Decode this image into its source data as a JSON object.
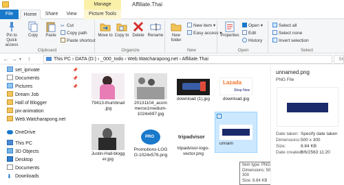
{
  "window": {
    "title": "Affiliate.Thai",
    "context_tab_group": "Manage"
  },
  "tabs": [
    "File",
    "Home",
    "Share",
    "View",
    "Picture Tools"
  ],
  "ribbon": {
    "clipboard": {
      "label": "Clipboard",
      "pin": "Pin to Quick access",
      "copy": "Copy",
      "paste": "Paste",
      "cut": "Cut",
      "copy_path": "Copy path",
      "paste_shortcut": "Paste shortcut"
    },
    "organize": {
      "label": "Organize",
      "move_to": "Move to",
      "copy_to": "Copy to",
      "delete": "Delete",
      "rename": "Rename"
    },
    "new": {
      "label": "New",
      "new_folder": "New folder",
      "new_item": "New item",
      "easy_access": "Easy access"
    },
    "open": {
      "label": "Open",
      "properties": "Properties",
      "open": "Open",
      "edit": "Edit",
      "history": "History"
    },
    "select": {
      "label": "Select",
      "select_all": "Select all",
      "select_none": "Select none",
      "invert": "Invert selection"
    }
  },
  "address": {
    "path": "This PC  ›  DATA (D:)  ›  _000_todo  ›  Web.Watcharapong.net  ›  Affiliate.Thai",
    "search": "Search"
  },
  "nav": [
    {
      "label": "set_iprivate",
      "icon": "image-folder-icon",
      "pinned": true
    },
    {
      "label": "Documents",
      "icon": "documents-icon",
      "pinned": true
    },
    {
      "label": "Pictures",
      "icon": "pictures-icon",
      "pinned": true
    },
    {
      "label": "Dream Job",
      "icon": "folder-icon",
      "pinned": false
    },
    {
      "label": "Hall of Blogger",
      "icon": "folder-icon",
      "pinned": false
    },
    {
      "label": "pix-animation",
      "icon": "folder-icon",
      "pinned": false
    },
    {
      "label": "Web.Watcharapong.net",
      "icon": "folder-icon",
      "pinned": false
    },
    {
      "label": "OneDrive",
      "icon": "onedrive-icon",
      "pinned": false
    },
    {
      "label": "This PC",
      "icon": "pc-icon",
      "pinned": false
    },
    {
      "label": "3D Objects",
      "icon": "3d-objects-icon",
      "pinned": false
    },
    {
      "label": "Desktop",
      "icon": "desktop-icon",
      "pinned": false
    },
    {
      "label": "Documents",
      "icon": "documents-icon",
      "pinned": false
    },
    {
      "label": "Downloads",
      "icon": "downloads-icon",
      "pinned": false
    }
  ],
  "files": [
    {
      "name": "79413-thumbnail.jpg",
      "line1": "79413-thumbnail",
      "line2": ".jpg"
    },
    {
      "name": "20131104_acommerce1medium-1024x697.jpg",
      "line1": "20131104_acom",
      "line2": "merce1medium-",
      "line3": "1024x697.jpg"
    },
    {
      "name": "download (1).jpg",
      "line1": "download (1).jpg"
    },
    {
      "name": "download.jpg",
      "line1": "download.jpg",
      "logo": "Lazada",
      "logo_sub": "Shop Now"
    },
    {
      "name": "Justin-Hall-blogger.jpg",
      "line1": "Justin-Hall-blogg",
      "line2": "er.jpg"
    },
    {
      "name": "Promotions-LOGO-1024x576.png",
      "line1": "Promotions-LOG",
      "line2": "O-1024x576.png",
      "logo": "PRO"
    },
    {
      "name": "tripadvisor-logo-vector.png",
      "line1": "tripadvisor-logo-",
      "line2": "vector.png",
      "logo": "tripadvisor"
    },
    {
      "name": "unnamed.png",
      "line1": "unnam",
      "selected": true
    }
  ],
  "tooltip": {
    "item_type": "Item type: PNG File",
    "dimensions": "Dimensions: 500 x 300",
    "size": "Size: 8.84 KB"
  },
  "details": {
    "name": "unnamed.png",
    "type": "PNG File",
    "date_taken_label": "Date taken:",
    "date_taken": "Specify date taken",
    "dimensions_label": "Dimensions:",
    "dimensions": "500 x 300",
    "size_label": "Size:",
    "size": "8.84 KB",
    "date_created_label": "Date created:",
    "date_created": "8/6/2563 11:20"
  },
  "colors": {
    "file_tab": "#1979ca",
    "manage_tab": "#fbf0a8",
    "selection": "#cce8ff"
  }
}
